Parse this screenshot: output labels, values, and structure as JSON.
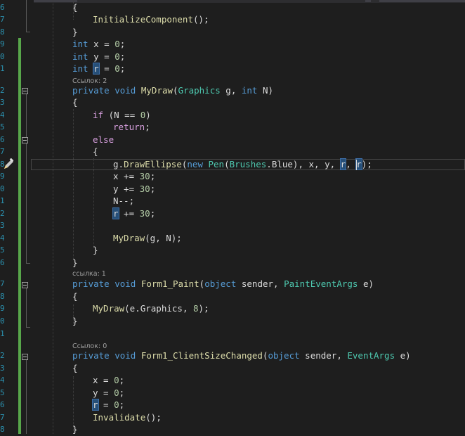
{
  "editor": {
    "line_numbers": [
      "6",
      "7",
      "8",
      "9",
      "0",
      "1",
      "2",
      "3",
      "4",
      "5",
      "6",
      "7",
      "8",
      "9",
      "0",
      "1",
      "2",
      "3",
      "4",
      "5",
      "6",
      "7",
      "8",
      "9",
      "0",
      "1",
      "2",
      "3",
      "4",
      "5",
      "6",
      "7",
      "8",
      "9"
    ],
    "code_lens": [
      "Ссылок: 2",
      "ссылка: 1",
      "Ссылок: 0"
    ],
    "icons": {
      "collapse": "collapse-minus-icon",
      "edit": "pencil-edit-icon"
    },
    "colors": {
      "keyword": "#569cd6",
      "control": "#d8a0df",
      "type": "#4ec9b0",
      "method": "#dcdcaa",
      "number": "#b5cea8",
      "text": "#dcdcdc",
      "change_bar": "#57a64a",
      "background": "#1e1e1e"
    }
  }
}
